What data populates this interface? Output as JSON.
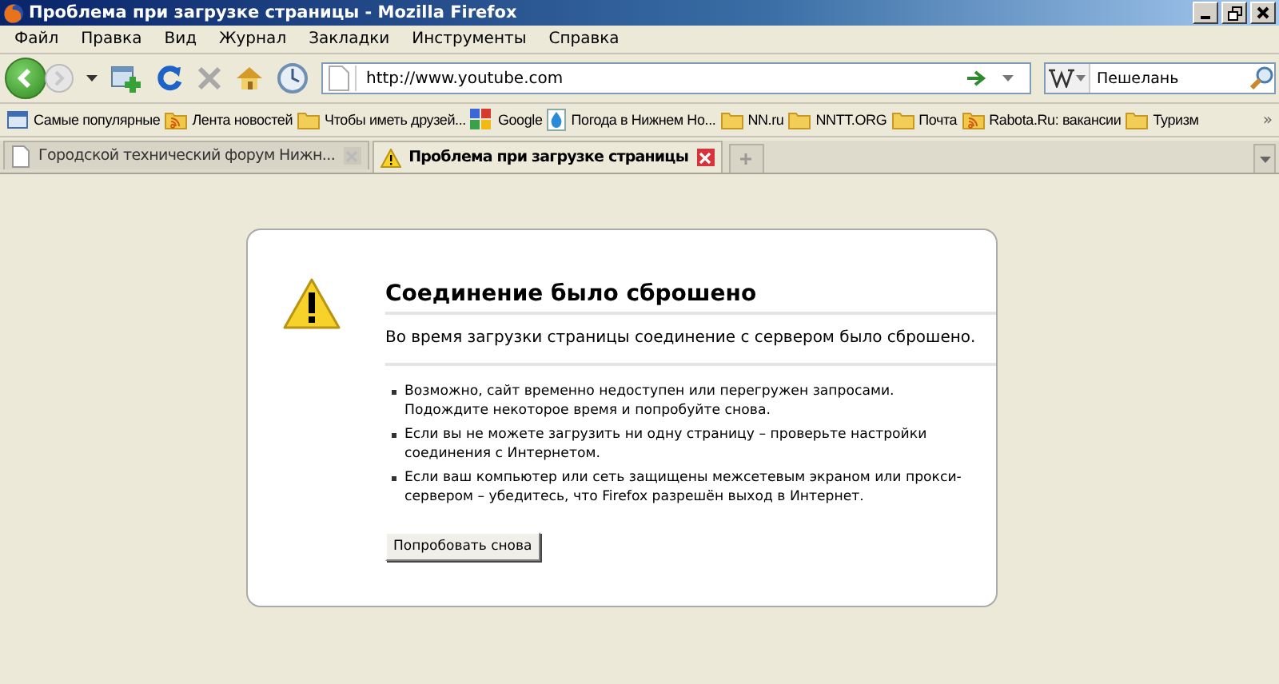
{
  "window": {
    "title": "Проблема при загрузке страницы - Mozilla Firefox"
  },
  "menu": [
    "Файл",
    "Правка",
    "Вид",
    "Журнал",
    "Закладки",
    "Инструменты",
    "Справка"
  ],
  "address": {
    "value": "http://www.youtube.com"
  },
  "search": {
    "value": "Пешелань"
  },
  "bookmarks": [
    {
      "label": "Самые популярные",
      "kind": "page"
    },
    {
      "label": "Лента новостей",
      "kind": "feed"
    },
    {
      "label": "Чтобы иметь друзей...",
      "kind": "folder"
    },
    {
      "label": "Google",
      "kind": "google"
    },
    {
      "label": "Погода в Нижнем Но...",
      "kind": "weather"
    },
    {
      "label": "NN.ru",
      "kind": "folder"
    },
    {
      "label": "NNTT.ORG",
      "kind": "folder"
    },
    {
      "label": "Почта",
      "kind": "folder"
    },
    {
      "label": "Rabota.Ru: вакансии",
      "kind": "feed"
    },
    {
      "label": "Туризм",
      "kind": "folder"
    }
  ],
  "bookmarks_more": "»",
  "tabs": [
    {
      "label": "Городской технический форум Нижн...",
      "selected": false,
      "kind": "page"
    },
    {
      "label": "Проблема при загрузке страницы",
      "selected": true,
      "kind": "warning"
    }
  ],
  "error": {
    "title": "Соединение было сброшено",
    "summary": "Во время загрузки страницы соединение с сервером было сброшено.",
    "bullets": [
      "Возможно, сайт временно недоступен или перегружен запросами. Подождите некоторое время и попробуйте снова.",
      "Если вы не можете загрузить ни одну страницу – проверьте настройки соединения с Интернетом.",
      "Если ваш компьютер или сеть защищены межсетевым экраном или прокси-сервером – убедитесь, что Firefox разрешён выход в Интернет."
    ],
    "button": "Попробовать снова"
  }
}
